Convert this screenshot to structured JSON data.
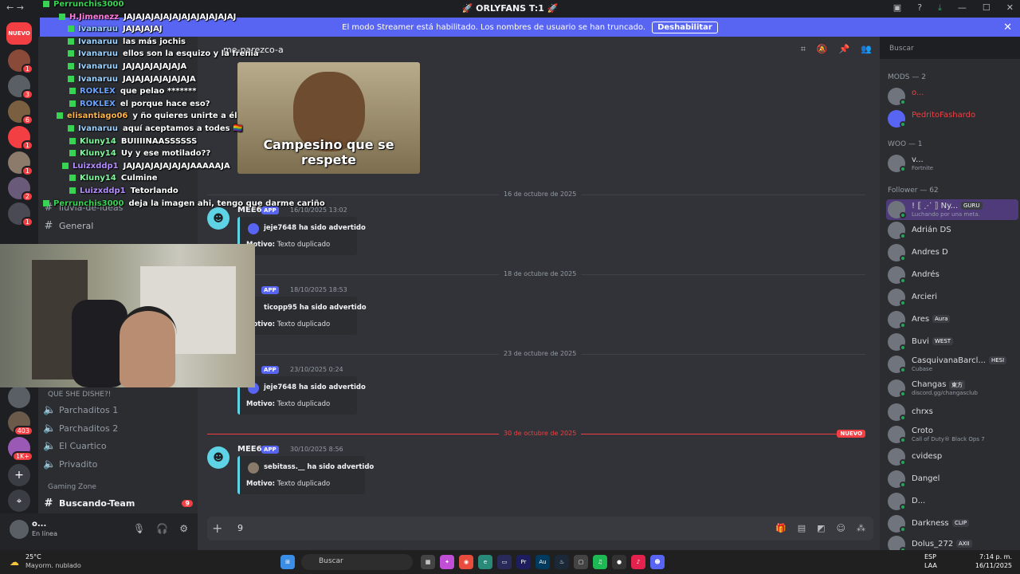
{
  "window": {
    "title": "🚀 ORLYFANS T:1 🚀"
  },
  "banner": {
    "text": "El modo Streamer está habilitado. Los nombres de usuario se han truncado.",
    "button": "Deshabilitar"
  },
  "servers": [
    {
      "label": "NUEVO",
      "badge": ""
    },
    {
      "label": "",
      "badge": "1"
    },
    {
      "label": "",
      "badge": "3"
    },
    {
      "label": "",
      "badge": "6"
    },
    {
      "label": "",
      "badge": "1"
    },
    {
      "label": "",
      "badge": "1"
    },
    {
      "label": "",
      "badge": "2"
    },
    {
      "label": "",
      "badge": "1"
    },
    {
      "label": "",
      "badge": "403"
    },
    {
      "label": "",
      "badge": "1K+"
    }
  ],
  "channels": {
    "items_top": [
      "lluvia-de-ideas",
      "General"
    ],
    "categories": [
      {
        "label": "QUE SHE DISHE?!"
      },
      {
        "label": "Gaming Zone"
      }
    ],
    "voice": [
      "Parchaditos 1",
      "Parchaditos 2",
      "El Cuartico",
      "Privadito"
    ],
    "gaming": {
      "name": "Buscando-Team",
      "badge": "9"
    }
  },
  "user": {
    "name": "o...",
    "status": "En línea"
  },
  "header": {
    "channel": "me-parezco-a",
    "search_placeholder": "Buscar"
  },
  "meme": {
    "caption": "Campesino que se respete"
  },
  "dividers": [
    "16 de octubre de 2025",
    "18 de octubre de 2025",
    "23 de octubre de 2025",
    "30 de octubre de 2025"
  ],
  "new_label": "NUEVO",
  "messages": [
    {
      "author": "MEE6",
      "app": "APP",
      "time": "16/10/2025 13:02",
      "title": "jeje7648 ha sido advertido",
      "motivo_label": "Motivo:",
      "motivo": "Texto duplicado"
    },
    {
      "author": "MEE6",
      "app": "APP",
      "time": "18/10/2025 18:53",
      "title": "ticopp95 ha sido advertido",
      "motivo_label": "Motivo:",
      "motivo": "Texto duplicado"
    },
    {
      "author": "MEE6",
      "app": "APP",
      "time": "23/10/2025 0:24",
      "title": "jeje7648 ha sido advertido",
      "motivo_label": "Motivo:",
      "motivo": "Texto duplicado"
    },
    {
      "author": "MEE6",
      "app": "APP",
      "time": "30/10/2025 8:56",
      "title": "sebitass.__ ha sido advertido",
      "motivo_label": "Motivo:",
      "motivo": "Texto duplicado"
    }
  ],
  "composer": {
    "text": "9"
  },
  "members": {
    "categories": [
      "MODS — 2",
      "WOO — 1",
      "Follower — 62"
    ],
    "mods": [
      {
        "name": "o...",
        "color": "#f23f43"
      },
      {
        "name": "PedritoFashardo",
        "color": "#f23f43"
      }
    ],
    "woo": [
      {
        "name": "v...",
        "sub": "Fortnite"
      }
    ],
    "followers": [
      {
        "name": "! ⟦ ⋰ ⟧ Ny...",
        "sub": "Luchando por una meta.",
        "tag": "GURU"
      },
      {
        "name": "Adrián DS",
        "sub": "",
        "tag": ""
      },
      {
        "name": "Andres D",
        "sub": "",
        "tag": ""
      },
      {
        "name": "Andrés",
        "sub": "",
        "tag": ""
      },
      {
        "name": "Arcieri",
        "sub": "",
        "tag": ""
      },
      {
        "name": "Ares",
        "sub": "",
        "tag": "Aura"
      },
      {
        "name": "Buvi",
        "sub": "",
        "tag": "WEST"
      },
      {
        "name": "CasquivanaBarcl...",
        "sub": "Cubase",
        "tag": "HESI"
      },
      {
        "name": "Changas",
        "sub": "discord.gg/changasclub",
        "tag": "東方"
      },
      {
        "name": "chrxs",
        "sub": "",
        "tag": ""
      },
      {
        "name": "Croto",
        "sub": "Call of Duty® Black Ops 7",
        "tag": ""
      },
      {
        "name": "cvidesp",
        "sub": "",
        "tag": ""
      },
      {
        "name": "Dangel",
        "sub": "",
        "tag": ""
      },
      {
        "name": "D...",
        "sub": "",
        "tag": ""
      },
      {
        "name": "Darkness",
        "sub": "",
        "tag": "CLIP"
      },
      {
        "name": "Dolus_272",
        "sub": "",
        "tag": "AXII"
      }
    ]
  },
  "chat_overlay": [
    {
      "user": "Perrunchis3000",
      "msg": "",
      "color": "#39d353"
    },
    {
      "user": "H.Jimenezz",
      "msg": "JAJAJAJAJAJAJAJAJAJAJAJAJ",
      "color": "#ff7ad9"
    },
    {
      "user": "Ivanaruu",
      "msg": "JAJAJAJAJ",
      "color": "#9ad1ff"
    },
    {
      "user": "Ivanaruu",
      "msg": "las más jochis",
      "color": "#9ad1ff"
    },
    {
      "user": "Ivanaruu",
      "msg": "ellos son la esquizo y la frenia",
      "color": "#9ad1ff"
    },
    {
      "user": "Ivanaruu",
      "msg": "JAJAJAJAJAJAJA",
      "color": "#9ad1ff"
    },
    {
      "user": "Ivanaruu",
      "msg": "JAJAJAJAJAJAJAJA",
      "color": "#9ad1ff"
    },
    {
      "user": "ROKLEX",
      "msg": "que pelao *******",
      "color": "#6aa2ff"
    },
    {
      "user": "ROKLEX",
      "msg": "el porque hace eso?",
      "color": "#6aa2ff"
    },
    {
      "user": "elisantiago06",
      "msg": "y ño quieres unirte a él",
      "color": "#ffb347"
    },
    {
      "user": "Ivanaruu",
      "msg": "aquí aceptamos a todes 🏳️‍🌈",
      "color": "#9ad1ff"
    },
    {
      "user": "Kluny14",
      "msg": "BUIIIINAASSSSSS",
      "color": "#7cfc9a"
    },
    {
      "user": "Kluny14",
      "msg": "Uy y ese motilado??",
      "color": "#7cfc9a"
    },
    {
      "user": "Luizxddp1",
      "msg": "JAJAJAJAJAJAJAJAAAAAJA",
      "color": "#b48cff"
    },
    {
      "user": "Kluny14",
      "msg": "Culmine",
      "color": "#7cfc9a"
    },
    {
      "user": "Luizxddp1",
      "msg": "Tetorlando",
      "color": "#b48cff"
    },
    {
      "user": "Perrunchis3000",
      "msg": "deja la imagen ahi, tengo que darme cariño",
      "color": "#39d353"
    }
  ],
  "taskbar": {
    "weather_temp": "25°C",
    "weather_desc": "Mayorm. nublado",
    "search": "Buscar",
    "lang1": "ESP",
    "lang2": "LAA",
    "time": "7:14 p. m.",
    "date": "16/11/2025"
  }
}
